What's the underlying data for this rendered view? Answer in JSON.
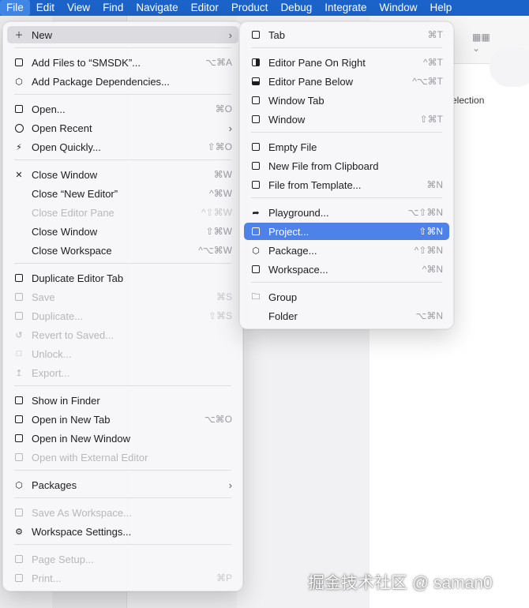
{
  "menubar": {
    "items": [
      "File",
      "Edit",
      "View",
      "Find",
      "Navigate",
      "Editor",
      "Product",
      "Debug",
      "Integrate",
      "Window",
      "Help"
    ]
  },
  "background": {
    "selection_text": "election"
  },
  "file_menu": {
    "items": [
      {
        "label": "New",
        "shortcut": "",
        "icon": "plus-icon"
      },
      {
        "label": "Add Files to “SMSDK”...",
        "shortcut": "⌥⌘A",
        "icon": "add-files-icon"
      },
      {
        "label": "Add Package Dependencies...",
        "shortcut": "",
        "icon": "package-icon"
      },
      {
        "label": "Open...",
        "shortcut": "⌘O",
        "icon": "open-icon"
      },
      {
        "label": "Open Recent",
        "shortcut": "",
        "icon": "clock-icon"
      },
      {
        "label": "Open Quickly...",
        "shortcut": "⇧⌘O",
        "icon": "bolt-icon"
      },
      {
        "label": "Close Window",
        "shortcut": "⌘W",
        "icon": "close-icon"
      },
      {
        "label": "Close “New Editor”",
        "shortcut": "^⌘W",
        "icon": ""
      },
      {
        "label": "Close Editor Pane",
        "shortcut": "^⇧⌘W",
        "icon": ""
      },
      {
        "label": "Close Window",
        "shortcut": "⇧⌘W",
        "icon": ""
      },
      {
        "label": "Close Workspace",
        "shortcut": "^⌥⌘W",
        "icon": ""
      },
      {
        "label": "Duplicate Editor Tab",
        "shortcut": "",
        "icon": "duplicate-tab-icon"
      },
      {
        "label": "Save",
        "shortcut": "⌘S",
        "icon": "save-icon"
      },
      {
        "label": "Duplicate...",
        "shortcut": "⇧⌘S",
        "icon": "duplicate-icon"
      },
      {
        "label": "Revert to Saved...",
        "shortcut": "",
        "icon": "revert-icon"
      },
      {
        "label": "Unlock...",
        "shortcut": "",
        "icon": "lock-icon"
      },
      {
        "label": "Export...",
        "shortcut": "",
        "icon": "export-icon"
      },
      {
        "label": "Show in Finder",
        "shortcut": "",
        "icon": "finder-icon"
      },
      {
        "label": "Open in New Tab",
        "shortcut": "⌥⌘O",
        "icon": "new-tab-icon"
      },
      {
        "label": "Open in New Window",
        "shortcut": "",
        "icon": "new-window-icon"
      },
      {
        "label": "Open with External Editor",
        "shortcut": "",
        "icon": "external-editor-icon"
      },
      {
        "label": "Packages",
        "shortcut": "",
        "icon": "package-icon"
      },
      {
        "label": "Save As Workspace...",
        "shortcut": "",
        "icon": "workspace-icon"
      },
      {
        "label": "Workspace Settings...",
        "shortcut": "",
        "icon": "gear-icon"
      },
      {
        "label": "Page Setup...",
        "shortcut": "",
        "icon": "page-icon"
      },
      {
        "label": "Print...",
        "shortcut": "⌘P",
        "icon": "printer-icon"
      }
    ]
  },
  "new_submenu": {
    "items": [
      {
        "label": "Tab",
        "shortcut": "⌘T"
      },
      {
        "label": "Editor Pane On Right",
        "shortcut": "^⌘T"
      },
      {
        "label": "Editor Pane Below",
        "shortcut": "^⌥⌘T"
      },
      {
        "label": "Window Tab",
        "shortcut": ""
      },
      {
        "label": "Window",
        "shortcut": "⇧⌘T"
      },
      {
        "label": "Empty File",
        "shortcut": ""
      },
      {
        "label": "New File from Clipboard",
        "shortcut": ""
      },
      {
        "label": "File from Template...",
        "shortcut": "⌘N"
      },
      {
        "label": "Playground...",
        "shortcut": "⌥⇧⌘N"
      },
      {
        "label": "Project...",
        "shortcut": "⇧⌘N"
      },
      {
        "label": "Package...",
        "shortcut": "^⇧⌘N"
      },
      {
        "label": "Workspace...",
        "shortcut": "^⌘N"
      },
      {
        "label": "Group",
        "shortcut": ""
      },
      {
        "label": "Folder",
        "shortcut": "⌥⌘N"
      }
    ]
  },
  "colors": {
    "menubar": "#1b63c8",
    "selected_item": "#4f82e8"
  },
  "watermark": "掘金技术社区 @ saman0"
}
